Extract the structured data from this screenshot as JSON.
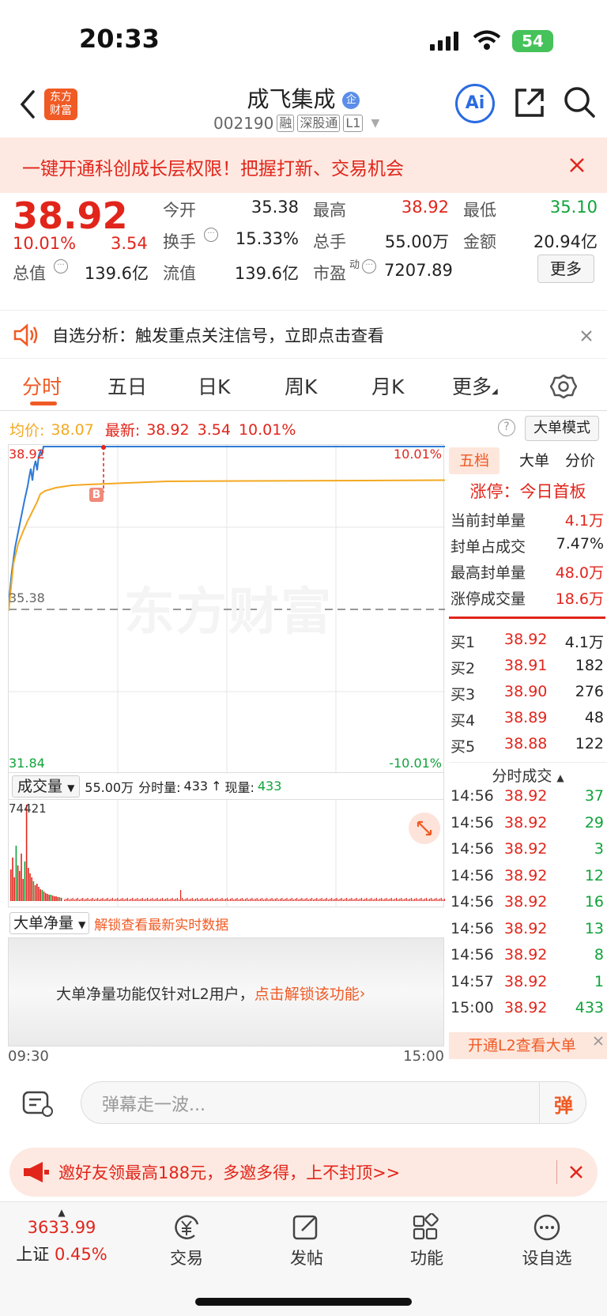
{
  "status_bar": {
    "time": "20:33",
    "battery": "54"
  },
  "header": {
    "logo_text": "东方\n财富",
    "title": "成飞集成",
    "title_badge": "企",
    "code": "002190",
    "tags": [
      "融",
      "深股通",
      "L1"
    ]
  },
  "promo": {
    "text": "一键开通科创成长层权限！把握打新、交易机会"
  },
  "quote": {
    "price": "38.92",
    "change_pct": "10.01%",
    "change": "3.54",
    "open_label": "今开",
    "open": "35.38",
    "high_label": "最高",
    "high": "38.92",
    "low_label": "最低",
    "low": "35.10",
    "turnover_label": "换手",
    "turnover": "15.33%",
    "volume_label": "总手",
    "volume": "55.00万",
    "amount_label": "金额",
    "amount": "20.94亿",
    "mcap_label": "总值",
    "mcap": "139.6亿",
    "float_label": "流值",
    "float": "139.6亿",
    "pe_label": "市盈",
    "pe_sup": "动",
    "pe": "7207.89",
    "more_button": "更多"
  },
  "analysis": {
    "text": "自选分析：触发重点关注信号，立即点击查看"
  },
  "tabs": [
    "分时",
    "五日",
    "日K",
    "周K",
    "月K",
    "更多"
  ],
  "chart_header": {
    "avg_label": "均价:",
    "avg": "38.07",
    "latest_label": "最新:",
    "latest": "38.92",
    "latest_chg": "3.54",
    "latest_pct": "10.01%",
    "mode_button": "大单模式"
  },
  "chart_labels": {
    "top_price": "38.92",
    "top_pct": "10.01%",
    "mid_price": "35.38",
    "bottom_price": "31.84",
    "bottom_pct": "-10.01%",
    "marker": "B",
    "watermark": "东方财富"
  },
  "volume_header": {
    "selector": "成交量",
    "total": "55.00万",
    "minute_label": "分时量:",
    "minute_val": "433",
    "now_label": "现量:",
    "now_val": "433",
    "max_label": "74421"
  },
  "big_order": {
    "selector": "大单净量",
    "unlock_link": "解锁查看最新实时数据",
    "locked_text": "大单净量功能仅针对L2用户，",
    "locked_link": "点击解锁该功能"
  },
  "time_axis": {
    "start": "09:30",
    "end": "15:00"
  },
  "right_panel": {
    "tabs": [
      "五档",
      "大单",
      "分价"
    ],
    "limit_title": "涨停：今日首板",
    "limit_rows": [
      {
        "label": "当前封单量",
        "value": "4.1万"
      },
      {
        "label": "封单占成交",
        "value": "7.47%"
      },
      {
        "label": "最高封单量",
        "value": "48.0万"
      },
      {
        "label": "涨停成交量",
        "value": "18.6万"
      }
    ],
    "bids": [
      {
        "label": "买1",
        "price": "38.92",
        "vol": "4.1万"
      },
      {
        "label": "买2",
        "price": "38.91",
        "vol": "182"
      },
      {
        "label": "买3",
        "price": "38.90",
        "vol": "276"
      },
      {
        "label": "买4",
        "price": "38.89",
        "vol": "48"
      },
      {
        "label": "买5",
        "price": "38.88",
        "vol": "122"
      }
    ],
    "trades_title": "分时成交",
    "trades": [
      {
        "time": "14:56",
        "price": "38.92",
        "vol": "37"
      },
      {
        "time": "14:56",
        "price": "38.92",
        "vol": "29"
      },
      {
        "time": "14:56",
        "price": "38.92",
        "vol": "3"
      },
      {
        "time": "14:56",
        "price": "38.92",
        "vol": "12"
      },
      {
        "time": "14:56",
        "price": "38.92",
        "vol": "16"
      },
      {
        "time": "14:56",
        "price": "38.92",
        "vol": "13"
      },
      {
        "time": "14:56",
        "price": "38.92",
        "vol": "8"
      },
      {
        "time": "14:57",
        "price": "38.92",
        "vol": "1"
      },
      {
        "time": "15:00",
        "price": "38.92",
        "vol": "433"
      }
    ],
    "l2_link": "开通L2查看大单"
  },
  "comment": {
    "placeholder": "弹幕走一波...",
    "send_icon_text": "弹"
  },
  "invite": {
    "text": "邀好友领最高188元，多邀多得，上不封顶>>"
  },
  "bottom_nav": {
    "index_value": "3633.99",
    "index_name": "上证",
    "index_pct": "0.45%",
    "items": [
      "交易",
      "发帖",
      "功能",
      "设自选"
    ]
  },
  "colors": {
    "up": "#e1251b",
    "down": "#10a33a",
    "accent": "#f05a24",
    "avg_line": "#f3a922",
    "price_line": "#2f7bd6"
  }
}
